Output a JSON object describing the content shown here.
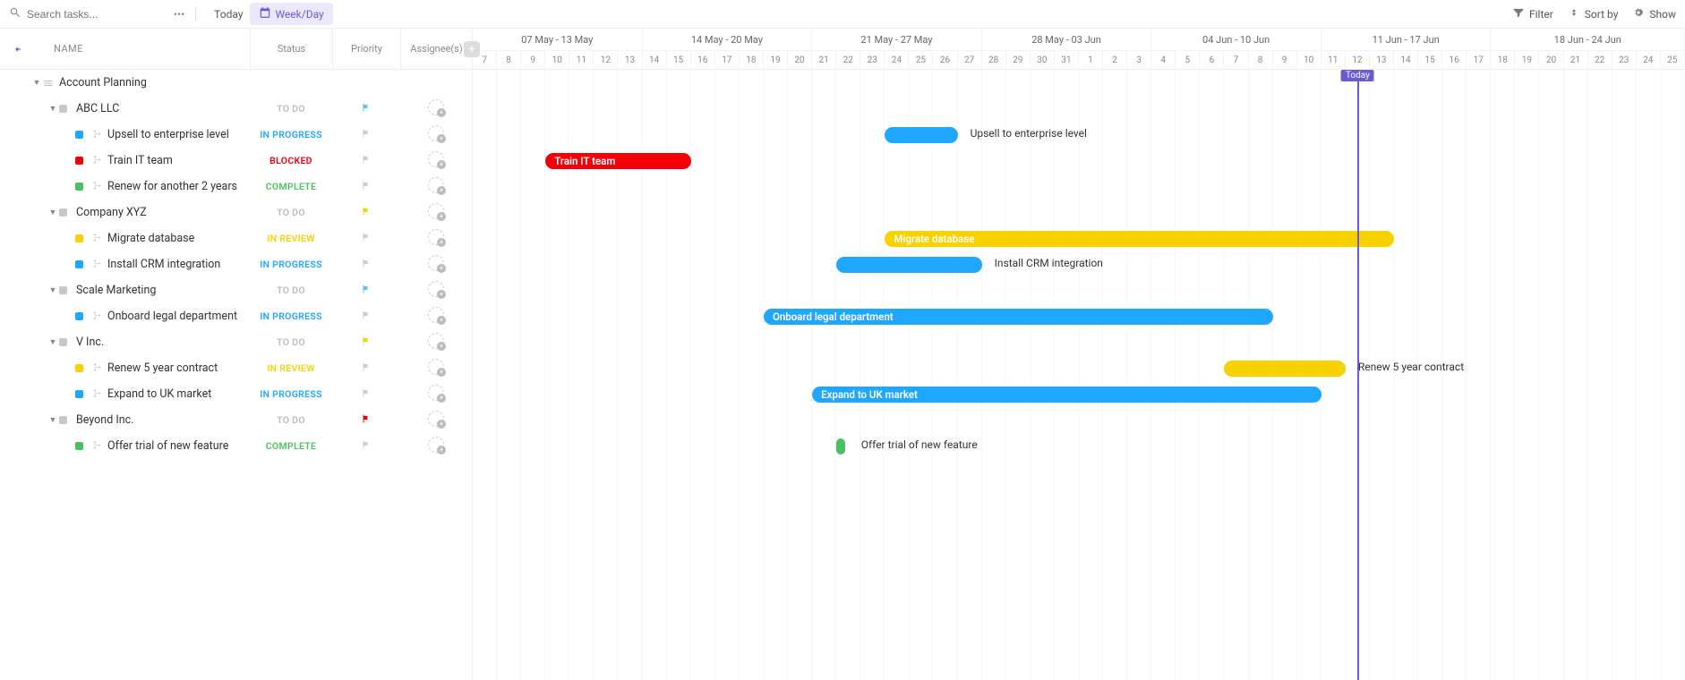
{
  "toolbar": {
    "search_placeholder": "Search tasks...",
    "today_label": "Today",
    "weekday_label": "Week/Day",
    "filter_label": "Filter",
    "sort_label": "Sort by",
    "show_label": "Show"
  },
  "columns": {
    "name": "NAME",
    "status": "Status",
    "priority": "Priority",
    "assignee": "Assignee(s)"
  },
  "today_badge": "Today",
  "weeks": [
    "07 May - 13 May",
    "14 May - 20 May",
    "21 May - 27 May",
    "28 May - 03 Jun",
    "04 Jun - 10 Jun",
    "11 Jun - 17 Jun",
    "18 Jun - 24 Jun"
  ],
  "days": [
    "7",
    "8",
    "9",
    "10",
    "11",
    "12",
    "13",
    "14",
    "15",
    "16",
    "17",
    "18",
    "19",
    "20",
    "21",
    "22",
    "23",
    "24",
    "25",
    "26",
    "27",
    "28",
    "29",
    "30",
    "31",
    "1",
    "2",
    "3",
    "4",
    "5",
    "6",
    "7",
    "8",
    "9",
    "10",
    "11",
    "12",
    "13",
    "14",
    "15",
    "16",
    "17",
    "18",
    "19",
    "20",
    "21",
    "22",
    "23",
    "24",
    "25"
  ],
  "today_day_index": 36,
  "rows": [
    {
      "type": "folder",
      "indent": 0,
      "label": "Account Planning",
      "has_hamb": true
    },
    {
      "type": "group",
      "indent": 1,
      "label": "ABC LLC",
      "color": "gray",
      "status": "TO DO",
      "status_class": "todo",
      "flag": "cyan"
    },
    {
      "type": "task",
      "indent": 2,
      "label": "Upsell to enterprise level",
      "color": "blue",
      "status": "IN PROGRESS",
      "status_class": "progress",
      "flag": "gray",
      "bar": {
        "start": 17,
        "span": 3,
        "color": "blue",
        "ext_label": "Upsell to enterprise level"
      }
    },
    {
      "type": "task",
      "indent": 2,
      "label": "Train IT team",
      "color": "red",
      "status": "BLOCKED",
      "status_class": "blocked",
      "flag": "gray",
      "bar": {
        "start": 3,
        "span": 6,
        "color": "red",
        "inline_label": "Train IT team"
      }
    },
    {
      "type": "task",
      "indent": 2,
      "label": "Renew for another 2 years",
      "color": "green",
      "status": "COMPLETE",
      "status_class": "complete",
      "flag": "gray"
    },
    {
      "type": "group",
      "indent": 1,
      "label": "Company XYZ",
      "color": "gray",
      "status": "TO DO",
      "status_class": "todo",
      "flag": "yellow"
    },
    {
      "type": "task",
      "indent": 2,
      "label": "Migrate database",
      "color": "yellow",
      "status": "IN REVIEW",
      "status_class": "review",
      "flag": "gray",
      "bar": {
        "start": 17,
        "span": 21,
        "color": "yellow",
        "inline_label": "Migrate database"
      }
    },
    {
      "type": "task",
      "indent": 2,
      "label": "Install CRM integration",
      "color": "blue",
      "status": "IN PROGRESS",
      "status_class": "progress",
      "flag": "gray",
      "bar": {
        "start": 15,
        "span": 6,
        "color": "blue",
        "ext_label": "Install CRM integration"
      }
    },
    {
      "type": "group",
      "indent": 1,
      "label": "Scale Marketing",
      "color": "gray",
      "status": "TO DO",
      "status_class": "todo",
      "flag": "cyan"
    },
    {
      "type": "task",
      "indent": 2,
      "label": "Onboard legal department",
      "color": "blue",
      "status": "IN PROGRESS",
      "status_class": "progress",
      "flag": "gray",
      "bar": {
        "start": 12,
        "span": 21,
        "color": "blue",
        "inline_label": "Onboard legal department"
      }
    },
    {
      "type": "group",
      "indent": 1,
      "label": "V Inc.",
      "color": "gray",
      "status": "TO DO",
      "status_class": "todo",
      "flag": "yellow"
    },
    {
      "type": "task",
      "indent": 2,
      "label": "Renew 5 year contract",
      "color": "yellow",
      "status": "IN REVIEW",
      "status_class": "review",
      "flag": "gray",
      "bar": {
        "start": 31,
        "span": 5,
        "color": "yellow",
        "ext_label": "Renew 5 year contract"
      }
    },
    {
      "type": "task",
      "indent": 2,
      "label": "Expand to UK market",
      "color": "blue",
      "status": "IN PROGRESS",
      "status_class": "progress",
      "flag": "gray",
      "bar": {
        "start": 14,
        "span": 21,
        "color": "blue",
        "inline_label": "Expand to UK market"
      }
    },
    {
      "type": "group",
      "indent": 1,
      "label": "Beyond Inc.",
      "color": "gray",
      "status": "TO DO",
      "status_class": "todo",
      "flag": "red"
    },
    {
      "type": "task",
      "indent": 2,
      "label": "Offer trial of new feature",
      "color": "green",
      "status": "COMPLETE",
      "status_class": "complete",
      "flag": "gray",
      "bar": {
        "start": 15,
        "span": 0.5,
        "color": "green",
        "ext_label": "Offer trial of new feature"
      }
    }
  ]
}
